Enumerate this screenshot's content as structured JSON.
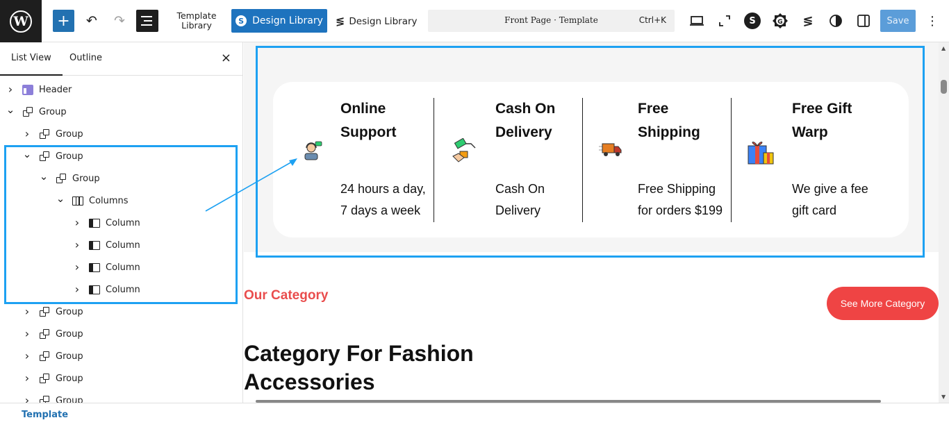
{
  "toolbar": {
    "wp_logo": "W",
    "add_icon": "+",
    "undo_icon": "↶",
    "redo_icon": "↷",
    "template_library_line1": "Template",
    "template_library_line2": "Library",
    "design_library_button": "Design Library",
    "design_library_link": "Design Library",
    "command_title": "Front Page · Template",
    "command_shortcut": "Ctrl+K",
    "save_label": "Save",
    "more_icon": "⋮"
  },
  "sidebar": {
    "tabs": [
      {
        "label": "List View",
        "active": true
      },
      {
        "label": "Outline",
        "active": false
      }
    ],
    "close_icon": "×",
    "items": [
      {
        "label": "Header",
        "icon": "template-part-icon",
        "expanded": false
      },
      {
        "label": "Group",
        "icon": "group-icon",
        "expanded": true
      },
      {
        "label": "Group",
        "icon": "group-icon",
        "expanded": false
      },
      {
        "label": "Group",
        "icon": "group-icon",
        "expanded": true
      },
      {
        "label": "Group",
        "icon": "group-icon",
        "expanded": true
      },
      {
        "label": "Columns",
        "icon": "columns-icon",
        "expanded": true
      },
      {
        "label": "Column",
        "icon": "column-icon",
        "expanded": false
      },
      {
        "label": "Column",
        "icon": "column-icon",
        "expanded": false
      },
      {
        "label": "Column",
        "icon": "column-icon",
        "expanded": false
      },
      {
        "label": "Column",
        "icon": "column-icon",
        "expanded": false
      },
      {
        "label": "Group",
        "icon": "group-icon",
        "expanded": false
      },
      {
        "label": "Group",
        "icon": "group-icon",
        "expanded": false
      },
      {
        "label": "Group",
        "icon": "group-icon",
        "expanded": false
      },
      {
        "label": "Group",
        "icon": "group-icon",
        "expanded": false
      },
      {
        "label": "Group",
        "icon": "group-icon",
        "expanded": false
      }
    ]
  },
  "canvas": {
    "features": [
      {
        "title_line1": "Online",
        "title_line2": "Support",
        "desc_line1": "24 hours a day,",
        "desc_line2": "7 days a week",
        "icon": "support-agent-icon"
      },
      {
        "title_line1": "Cash On",
        "title_line2": "Delivery",
        "desc_line1": "Cash On",
        "desc_line2": "Delivery",
        "icon": "cash-hand-icon"
      },
      {
        "title_line1": "Free",
        "title_line2": "Shipping",
        "desc_line1": "Free Shipping",
        "desc_line2": "for orders $199",
        "icon": "delivery-truck-icon"
      },
      {
        "title_line1": "Free Gift",
        "title_line2": "Warp",
        "desc_line1": "We give a fee",
        "desc_line2": "gift card",
        "icon": "gift-box-icon"
      }
    ],
    "our_category": "Our Category",
    "see_more_button": "See More Category",
    "category_heading_line1": "Category For Fashion",
    "category_heading_line2": "Accessories"
  },
  "footer": {
    "label": "Template"
  },
  "colors": {
    "accent": "#1e73be",
    "highlight": "#1da1f2",
    "category_red": "#e94d4d",
    "button_red": "#ef4444",
    "footer_link": "#2271b1"
  }
}
